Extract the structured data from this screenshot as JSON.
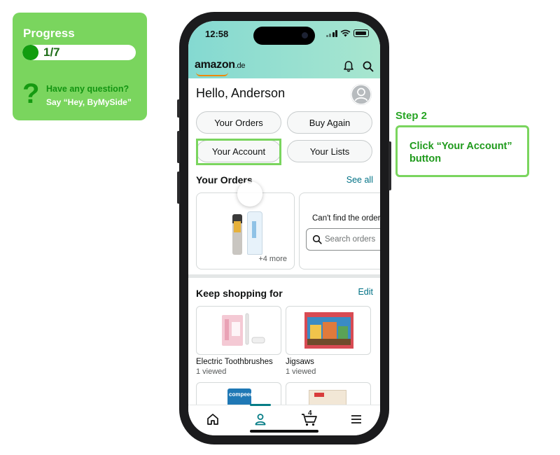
{
  "progress": {
    "title": "Progress",
    "text": "1/7",
    "fraction": 0.143,
    "help_question": "Have any question?",
    "help_say": "Say “Hey, ByMySide”"
  },
  "step": {
    "label": "Step 2",
    "instruction": "Click “Your Account” button"
  },
  "status_bar": {
    "time": "12:58"
  },
  "header": {
    "logo_text": "amazon",
    "logo_tld": ".de",
    "icons": [
      "bell-icon",
      "search-icon"
    ]
  },
  "greeting": "Hello, Anderson",
  "quick_buttons": {
    "your_orders": "Your Orders",
    "buy_again": "Buy Again",
    "your_account": "Your Account",
    "your_lists": "Your Lists"
  },
  "orders_section": {
    "title": "Your Orders",
    "see_all": "See all",
    "more_text": "+4 more",
    "cant_find": "Can't find the order",
    "search_placeholder": "Search orders"
  },
  "keep_shopping": {
    "title": "Keep shopping for",
    "edit": "Edit",
    "items": [
      {
        "name": "Electric Toothbrushes",
        "viewed": "1 viewed"
      },
      {
        "name": "Jigsaws",
        "viewed": "1 viewed"
      }
    ],
    "partial_labels": [
      "compeed"
    ]
  },
  "bottom_nav": {
    "active": "account",
    "cart_count": "4",
    "icons": [
      "home-icon",
      "account-icon",
      "cart-icon",
      "menu-icon"
    ]
  },
  "colors": {
    "accent_green": "#7ad55e",
    "teal": "#067d86",
    "link": "#007185"
  }
}
